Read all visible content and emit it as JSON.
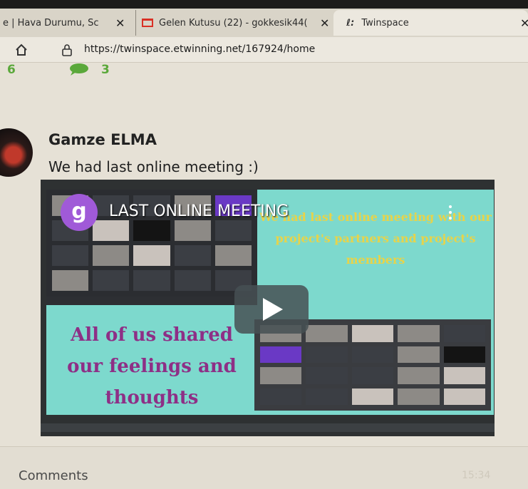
{
  "browser": {
    "tabs": [
      {
        "title": "e | Hava Durumu, Sc",
        "close": "✕"
      },
      {
        "title": "Gelen Kutusu (22) - gokkesik44(",
        "close": "✕"
      },
      {
        "title": "Twinspace",
        "close": "✕"
      }
    ],
    "url": "https://twinspace.etwinning.net/167924/home"
  },
  "stats": {
    "likes": "6",
    "comments": "3"
  },
  "post": {
    "author": "Gamze ELMA",
    "text": "We had last online meeting :)"
  },
  "video": {
    "channel_initial": "g",
    "title": "LAST ONLINE MEETING",
    "slide_yellow_text": "We had last online meeting with our project's partners and project's members",
    "slide_purple_text": "All of us shared our feelings and thoughts"
  },
  "footer": {
    "comments_label": "Comments",
    "time": "15:34"
  },
  "colors": {
    "accent_green": "#5aa83a",
    "slide_teal": "#7dd9cd",
    "title_purple": "#8e2f86",
    "slide_yellow": "#e7d34a"
  }
}
